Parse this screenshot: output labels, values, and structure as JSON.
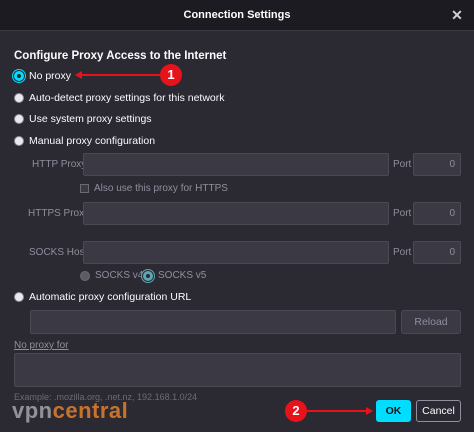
{
  "window": {
    "title": "Connection Settings",
    "close_glyph": "✕"
  },
  "section_title": "Configure Proxy Access to the Internet",
  "radios": {
    "no_proxy": "No proxy",
    "auto_detect": "Auto-detect proxy settings for this network",
    "system": "Use system proxy settings",
    "manual": "Manual proxy configuration",
    "automatic_url": "Automatic proxy configuration URL"
  },
  "manual": {
    "http_label": "HTTP Proxy",
    "http_port_label": "Port",
    "http_port_value": "0",
    "https_checkbox_label": "Also use this proxy for HTTPS",
    "https_label": "HTTPS Proxy",
    "https_port_label": "Port",
    "https_port_value": "0",
    "socks_label": "SOCKS Host",
    "socks_port_label": "Port",
    "socks_port_value": "0",
    "socks_v4": "SOCKS v4",
    "socks_v5": "SOCKS v5"
  },
  "auto_url": {
    "reload_label": "Reload"
  },
  "no_proxy_for": {
    "label": "No proxy for",
    "example": "Example: .mozilla.org, .net.nz, 192.168.1.0/24"
  },
  "buttons": {
    "ok": "OK",
    "cancel": "Cancel"
  },
  "annotations": {
    "step1": "1",
    "step2": "2"
  },
  "watermark": {
    "part1": "vpn",
    "part2": "central"
  },
  "colors": {
    "accent": "#00ddff",
    "annotation": "#e8121b",
    "background": "#2b2a33"
  }
}
